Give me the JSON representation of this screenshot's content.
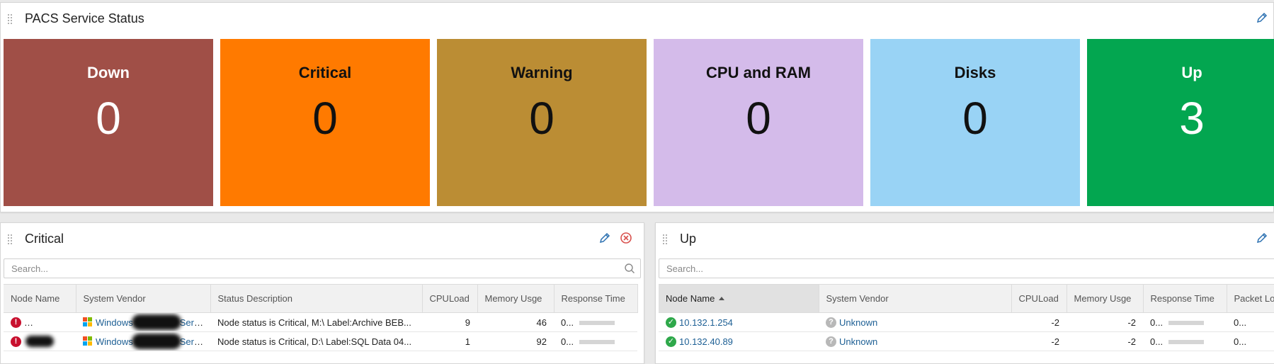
{
  "status_widget": {
    "title": "PACS Service Status",
    "tiles": [
      {
        "label": "Down",
        "count": "0",
        "bg": "#a04f47",
        "fg": "#ffffff"
      },
      {
        "label": "Critical",
        "count": "0",
        "bg": "#ff7a00",
        "fg": "#111111"
      },
      {
        "label": "Warning",
        "count": "0",
        "bg": "#bb8d34",
        "fg": "#111111"
      },
      {
        "label": "CPU and RAM",
        "count": "0",
        "bg": "#d4bbea",
        "fg": "#111111"
      },
      {
        "label": "Disks",
        "count": "0",
        "bg": "#99d3f5",
        "fg": "#111111"
      },
      {
        "label": "Up",
        "count": "3",
        "bg": "#03a650",
        "fg": "#ffffff"
      }
    ]
  },
  "critical_widget": {
    "title": "Critical",
    "search_placeholder": "Search...",
    "columns": [
      "Node Name",
      "System Vendor",
      "Status Description",
      "CPULoad",
      "Memory Usge",
      "Response Time"
    ],
    "rows": [
      {
        "node": "",
        "vendor_a": "Windows",
        "vendor_b": "Server",
        "status": "Node status is Critical, M:\\ Label:Archive BEB...",
        "cpu": "9",
        "mem": "46",
        "resp": "0..."
      },
      {
        "node": "",
        "vendor_a": "Windows",
        "vendor_b": "Server",
        "status": "Node status is Critical, D:\\ Label:SQL Data 04...",
        "cpu": "1",
        "mem": "92",
        "resp": "0..."
      }
    ]
  },
  "up_widget": {
    "title": "Up",
    "search_placeholder": "Search...",
    "columns": [
      "Node Name",
      "System Vendor",
      "CPULoad",
      "Memory Usge",
      "Response Time",
      "Packet Lo"
    ],
    "rows": [
      {
        "node": "10.132.1.254",
        "vendor": "Unknown",
        "cpu": "-2",
        "mem": "-2",
        "resp": "0...",
        "packet": "0..."
      },
      {
        "node": "10.132.40.89",
        "vendor": "Unknown",
        "cpu": "-2",
        "mem": "-2",
        "resp": "0...",
        "packet": "0..."
      }
    ]
  },
  "icons": {
    "drag": "drag-handle-icon",
    "edit": "pencil-icon",
    "close": "close-circle-icon",
    "search": "search-icon",
    "critical_status": "critical-exclamation-icon",
    "up_status": "up-check-icon",
    "unknown_vendor": "question-icon",
    "windows": "windows-logo-icon"
  },
  "colors": {
    "link": "#1d5f94",
    "critical": "#c8102e",
    "up": "#2ea84a",
    "edit": "#2a6fb0",
    "close": "#d9534f"
  }
}
